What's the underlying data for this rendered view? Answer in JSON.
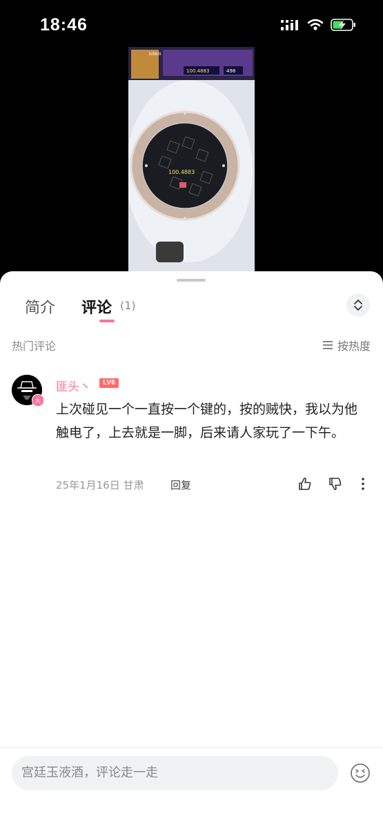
{
  "status_bar": {
    "time": "18:46"
  },
  "video": {
    "watermark": "bilibili",
    "game_score": "100.4883",
    "game_counter": "498",
    "machine_reading": "100.4883"
  },
  "tabs": [
    {
      "label": "简介"
    },
    {
      "label": "评论",
      "count": "(1)"
    }
  ],
  "section": {
    "title": "热门评论",
    "sort_label": "按热度"
  },
  "comment": {
    "username": "匪头丶",
    "level": "LV6",
    "avatar_badge": "大",
    "text": "上次碰见一个一直按一个键的，按的贼快，我以为他触电了，上去就是一脚，后来请人家玩了一下午。",
    "meta": "25年1月16日 甘肃",
    "reply_label": "回复"
  },
  "input": {
    "placeholder": "宫廷玉液酒，评论走一走"
  },
  "colors": {
    "accent": "#fb7299",
    "level": "#ff6a6a",
    "sheet_bg": "#ffffff"
  },
  "icons": [
    "signal-icon",
    "wifi-icon",
    "battery-charging-icon",
    "expand-icon",
    "sort-icon",
    "like-icon",
    "dislike-icon",
    "more-icon",
    "emoji-icon"
  ]
}
